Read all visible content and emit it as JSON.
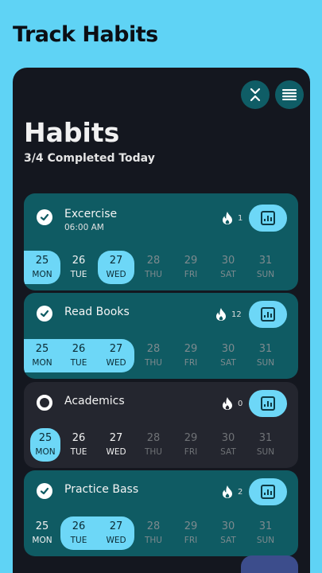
{
  "header": {
    "title": "Track Habits"
  },
  "panel": {
    "title": "Habits",
    "subtitle": "3/4 Completed Today"
  },
  "icons": {
    "collapse": "collapse-arrows-icon",
    "menu": "hamburger-menu-icon",
    "check": "check-icon",
    "flame": "flame-icon",
    "stats": "bar-chart-icon"
  },
  "colors": {
    "background": "#5fd3f5",
    "panel": "#14171f",
    "card_done": "#0f5b63",
    "card_pending": "#24262f",
    "accent": "#6dd7f7"
  },
  "habits": [
    {
      "name": "Excercise",
      "time": "06:00 AM",
      "streak": "1",
      "completed": true,
      "days": [
        {
          "num": "25",
          "wd": "MON",
          "state": "done"
        },
        {
          "num": "26",
          "wd": "TUE",
          "state": "missed"
        },
        {
          "num": "27",
          "wd": "WED",
          "state": "done"
        },
        {
          "num": "28",
          "wd": "THU",
          "state": "future"
        },
        {
          "num": "29",
          "wd": "FRI",
          "state": "future"
        },
        {
          "num": "30",
          "wd": "SAT",
          "state": "future"
        },
        {
          "num": "31",
          "wd": "SUN",
          "state": "future"
        }
      ]
    },
    {
      "name": "Read Books",
      "time": "",
      "streak": "12",
      "completed": true,
      "days": [
        {
          "num": "25",
          "wd": "MON",
          "state": "done"
        },
        {
          "num": "26",
          "wd": "TUE",
          "state": "done"
        },
        {
          "num": "27",
          "wd": "WED",
          "state": "done"
        },
        {
          "num": "28",
          "wd": "THU",
          "state": "future"
        },
        {
          "num": "29",
          "wd": "FRI",
          "state": "future"
        },
        {
          "num": "30",
          "wd": "SAT",
          "state": "future"
        },
        {
          "num": "31",
          "wd": "SUN",
          "state": "future"
        }
      ]
    },
    {
      "name": "Academics",
      "time": "",
      "streak": "0",
      "completed": false,
      "days": [
        {
          "num": "25",
          "wd": "MON",
          "state": "done"
        },
        {
          "num": "26",
          "wd": "TUE",
          "state": "missed"
        },
        {
          "num": "27",
          "wd": "WED",
          "state": "missed"
        },
        {
          "num": "28",
          "wd": "THU",
          "state": "future"
        },
        {
          "num": "29",
          "wd": "FRI",
          "state": "future"
        },
        {
          "num": "30",
          "wd": "SAT",
          "state": "future"
        },
        {
          "num": "31",
          "wd": "SUN",
          "state": "future"
        }
      ]
    },
    {
      "name": "Practice Bass",
      "time": "",
      "streak": "2",
      "completed": true,
      "days": [
        {
          "num": "25",
          "wd": "MON",
          "state": "missed"
        },
        {
          "num": "26",
          "wd": "TUE",
          "state": "done"
        },
        {
          "num": "27",
          "wd": "WED",
          "state": "done"
        },
        {
          "num": "28",
          "wd": "THU",
          "state": "future"
        },
        {
          "num": "29",
          "wd": "FRI",
          "state": "future"
        },
        {
          "num": "30",
          "wd": "SAT",
          "state": "future"
        },
        {
          "num": "31",
          "wd": "SUN",
          "state": "future"
        }
      ]
    }
  ]
}
